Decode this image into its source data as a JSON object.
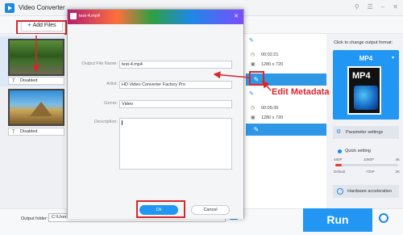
{
  "app": {
    "title": "Video Converter"
  },
  "toolbar": {
    "add_files_label": "Add Files"
  },
  "files": [
    {
      "subtitle": "Disabled"
    },
    {
      "subtitle": "Disabled"
    }
  ],
  "info": {
    "duration_1": "00:02:21",
    "resolution_1": "1280 x 720",
    "duration_2": "00:05:35",
    "resolution_2": "1280 x 720"
  },
  "annotation": {
    "edit_metadata": "Edit Metadata"
  },
  "right_panel": {
    "output_label": "Click to change output format:",
    "format": "MP4",
    "format_icon_text": "MP4",
    "parameter_settings": "Parameter settings",
    "quick_setting": "Quick setting",
    "quality_ticks": [
      "480P",
      "1080P",
      "4K"
    ],
    "quality_bottom": [
      "Default",
      "720P",
      "2K"
    ],
    "quality_level": 0.1,
    "hardware_acceleration": "Hardware acceleration"
  },
  "bottom": {
    "output_folder_label": "Output folder:",
    "output_folder_value": "C:\\Users\\Wonder-sx\\Desktop",
    "run_label": "Run"
  },
  "dialog": {
    "title": "test-4.mp4",
    "fields": {
      "output_file_name_label": "Output File Name:",
      "output_file_name_value": "test-4.mp4",
      "artist_label": "Artist:",
      "artist_value": "HD Video Converter Factory Pro",
      "genre_label": "Genre:",
      "genre_value": "Video",
      "description_label": "Description:"
    },
    "ok_label": "Ok",
    "cancel_label": "Cancel"
  },
  "colors": {
    "accent": "#2196f3",
    "highlight": "#d9262e"
  }
}
